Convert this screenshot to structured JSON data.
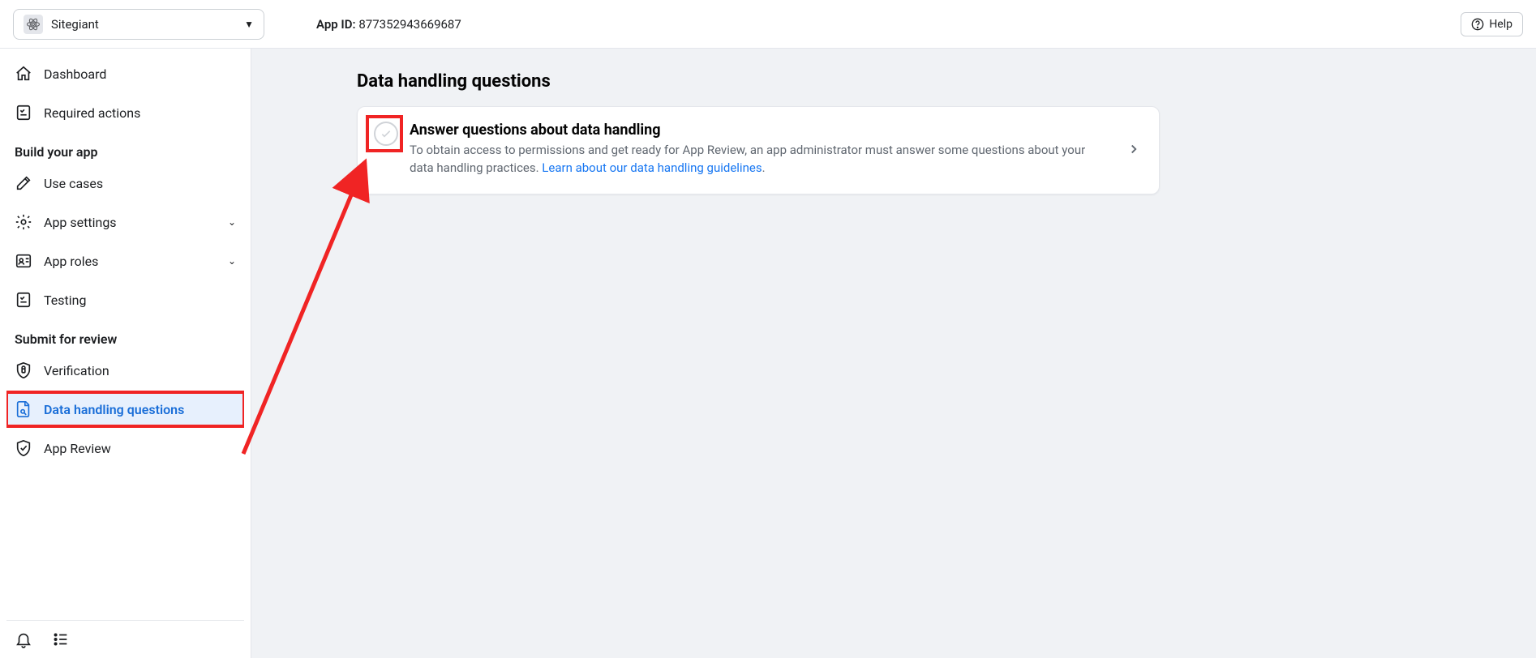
{
  "topbar": {
    "app_name": "Sitegiant",
    "app_id_label": "App ID:",
    "app_id_value": "877352943669687",
    "help_label": "Help"
  },
  "sidebar": {
    "items": [
      {
        "label": "Dashboard",
        "icon": "home",
        "expandable": false
      },
      {
        "label": "Required actions",
        "icon": "checklist",
        "expandable": false
      }
    ],
    "section_build": "Build your app",
    "build_items": [
      {
        "label": "Use cases",
        "icon": "pencil",
        "expandable": false
      },
      {
        "label": "App settings",
        "icon": "gear",
        "expandable": true
      },
      {
        "label": "App roles",
        "icon": "roles",
        "expandable": true
      },
      {
        "label": "Testing",
        "icon": "checklist",
        "expandable": false
      }
    ],
    "section_submit": "Submit for review",
    "submit_items": [
      {
        "label": "Verification",
        "icon": "shield-lock",
        "expandable": false,
        "active": false
      },
      {
        "label": "Data handling questions",
        "icon": "doc-search",
        "expandable": false,
        "active": true
      },
      {
        "label": "App Review",
        "icon": "shield-check",
        "expandable": false,
        "active": false
      }
    ]
  },
  "page": {
    "title": "Data handling questions",
    "card": {
      "title": "Answer questions about data handling",
      "description_before_link": "To obtain access to permissions and get ready for App Review, an app administrator must answer some questions about your data handling practices. ",
      "link_text": "Learn about our data handling guidelines",
      "description_after_link": "."
    }
  }
}
